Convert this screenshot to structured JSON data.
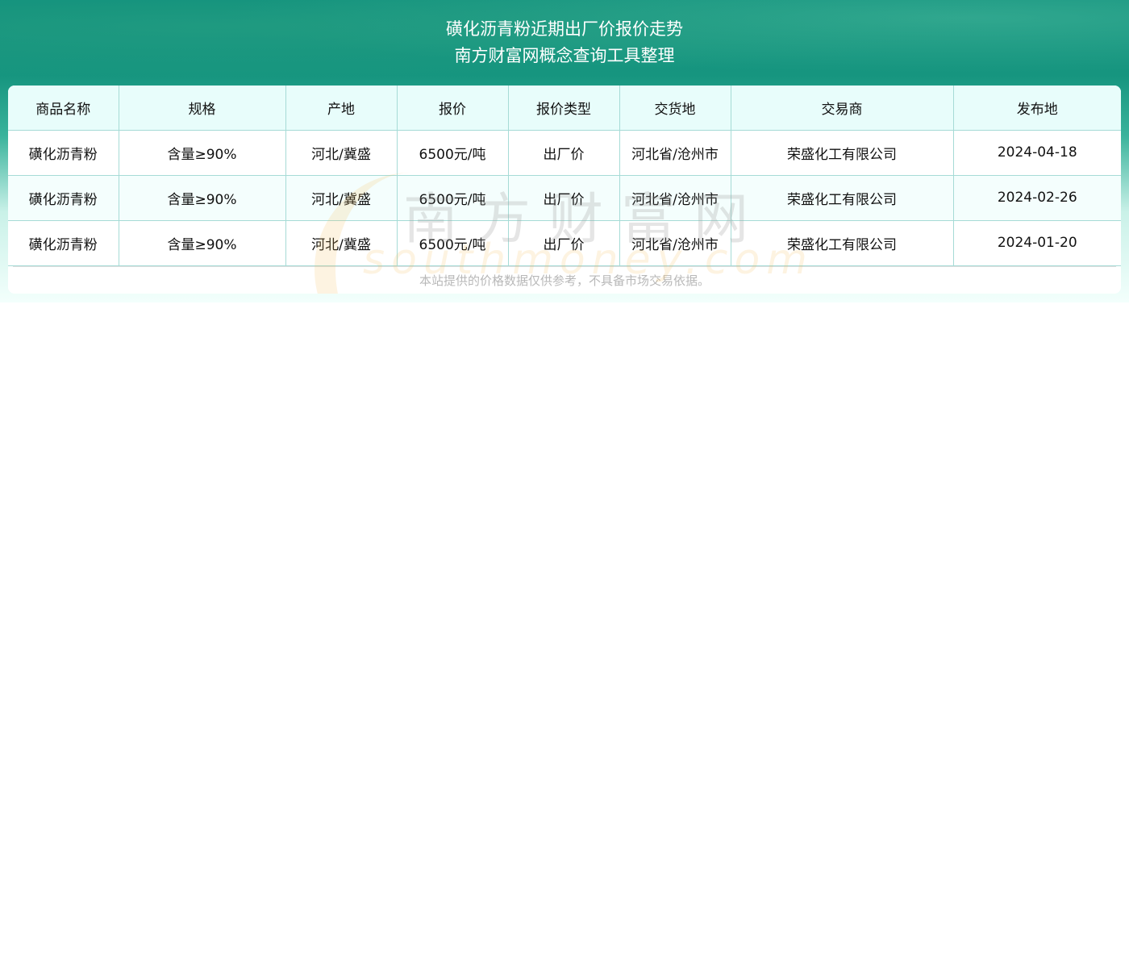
{
  "header": {
    "title": "磺化沥青粉近期出厂价报价走势",
    "subtitle": "南方财富网概念查询工具整理"
  },
  "table": {
    "columns": [
      "商品名称",
      "规格",
      "产地",
      "报价",
      "报价类型",
      "交货地",
      "交易商",
      "发布地"
    ],
    "rows": [
      [
        "磺化沥青粉",
        "含量≥90%",
        "河北/冀盛",
        "6500元/吨",
        "出厂价",
        "河北省/沧州市",
        "荣盛化工有限公司",
        "2024-04-18"
      ],
      [
        "磺化沥青粉",
        "含量≥90%",
        "河北/冀盛",
        "6500元/吨",
        "出厂价",
        "河北省/沧州市",
        "荣盛化工有限公司",
        "2024-02-26"
      ],
      [
        "磺化沥青粉",
        "含量≥90%",
        "河北/冀盛",
        "6500元/吨",
        "出厂价",
        "河北省/沧州市",
        "荣盛化工有限公司",
        "2024-01-20"
      ]
    ]
  },
  "footer": {
    "note": "本站提供的价格数据仅供参考，不具备市场交易依据。"
  },
  "watermark": {
    "cn": "南方财富网",
    "en": "southmoney.com"
  }
}
